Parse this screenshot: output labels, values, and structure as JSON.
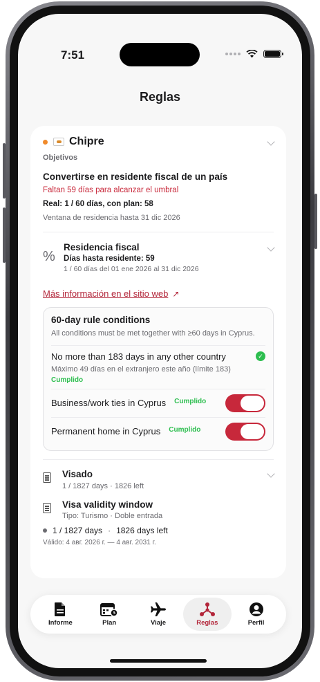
{
  "status_bar": {
    "time": "7:51"
  },
  "nav": {
    "title": "Reglas"
  },
  "country": {
    "name": "Chipre",
    "section_label": "Objetivos",
    "goal_title": "Convertirse en residente fiscal de un país",
    "warning": "Faltan 59 días para alcanzar el umbral",
    "real": "Real: 1 / 60 días, con plan: 58",
    "window": "Ventana de residencia hasta 31 dic 2026",
    "status_color": "#f08a2b"
  },
  "tax": {
    "title": "Residencia fiscal",
    "days_left": "Días hasta residente: 59",
    "range": "1 / 60 días del 01 ene 2026 al 31 dic 2026",
    "link": "Más información en el sitio web"
  },
  "conditions": {
    "title": "60-day rule conditions",
    "description": "All conditions must be met together with ≥60 days in Cyprus.",
    "items": [
      {
        "label": "No more than 183 days in any other country",
        "detail": "Máximo 49 días en el extranjero este año (límite 183)",
        "status": "Cumplido"
      },
      {
        "label": "Business/work ties in Cyprus",
        "status": "Cumplido"
      },
      {
        "label": "Permanent home in Cyprus",
        "status": "Cumplido"
      }
    ]
  },
  "visa": {
    "title": "Visado",
    "days": "1 / 1827 days · 1826 left",
    "window_title": "Visa validity window",
    "type": "Tipo: Turismo · Doble entrada",
    "progress": "1 / 1827 days",
    "sep": "·",
    "left": "1826 days left",
    "valid": "Válido: 4 авг. 2026 г. — 4 авг. 2031 г."
  },
  "tabs": [
    {
      "label": "Informe",
      "icon": "document-icon"
    },
    {
      "label": "Plan",
      "icon": "calendar-clock-icon"
    },
    {
      "label": "Viaje",
      "icon": "airplane-icon"
    },
    {
      "label": "Reglas",
      "icon": "network-icon"
    },
    {
      "label": "Perfil",
      "icon": "person-icon"
    }
  ],
  "colors": {
    "accent": "#b3263a",
    "success": "#2dbe4f"
  }
}
